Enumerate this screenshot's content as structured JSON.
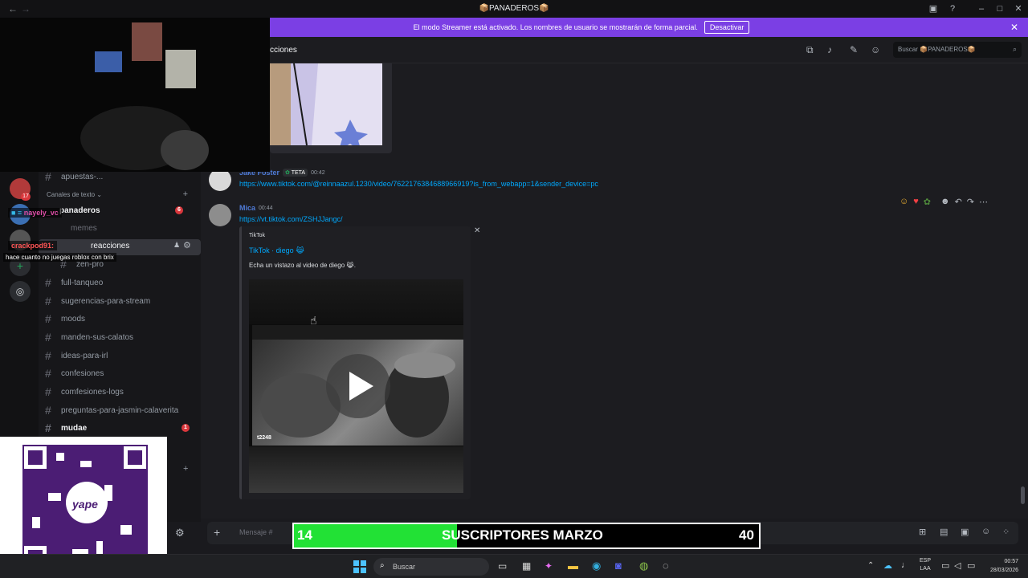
{
  "titlebar": {
    "title": "📦PANADEROS📦"
  },
  "banner": {
    "text": "El modo Streamer está activado. Los nombres de usuario se mostrarán de forma parcial.",
    "button": "Desactivar"
  },
  "header": {
    "channel_name": "cciones",
    "search_placeholder": "Buscar 📦PANADEROS📦"
  },
  "overlay": {
    "chat_user1": "nayely_vc",
    "chat_user2": "crackpod91",
    "chat_message": "hace cuanto no juegas roblox con brix"
  },
  "sidebar": {
    "top_channel": "apuestas-...",
    "section_label": "Canales de texto",
    "panaderos": "panaderos",
    "panaderos_badge": "6",
    "memes": "memes",
    "reacciones": "reacciones",
    "zen": "zen-pro",
    "channels": [
      "full-tanqueo",
      "sugerencias-para-stream",
      "moods",
      "manden-sus-calatos",
      "ideas-para-irl",
      "confesiones",
      "comfesiones-logs",
      "preguntas-para-jasmin-calaverita"
    ],
    "mudae": "mudae",
    "mudae_badge": "1",
    "server_badge": "17"
  },
  "messages": {
    "m1_author": "Jake Foster",
    "m1_tag": "TETA",
    "m1_time": "00:42",
    "m1_link": "https://www.tiktok.com/@reinnaazul.1230/video/7622176384688966919?is_from_webapp=1&sender_device=pc",
    "m2_author": "Mica",
    "m2_time": "00:44",
    "m2_link": "https://vt.tiktok.com/ZSHJJangc/",
    "embed_provider": "TikTok",
    "embed_title": "TikTok · diego 😹",
    "embed_desc": "Echa un vistazo al video de diego 😹.",
    "video_watermark": "t2248"
  },
  "composer": {
    "placeholder": "Mensaje #"
  },
  "subgoal": {
    "current": "14",
    "label": "SUSCRIPTORES MARZO",
    "target": "40",
    "progress": 0.35
  },
  "taskbar": {
    "search": "Buscar",
    "lang1": "ESP",
    "lang2": "LAA",
    "time": "00:57",
    "date": "28/03/2026"
  },
  "qr": {
    "logo": "yape"
  }
}
